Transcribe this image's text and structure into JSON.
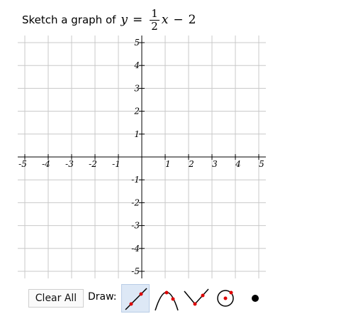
{
  "prompt": {
    "text": "Sketch a graph of",
    "var_y": "y",
    "equals": "=",
    "frac_num": "1",
    "frac_den": "2",
    "var_x": "x",
    "minus": "−",
    "constant": "2"
  },
  "graph": {
    "xlim": [
      -5,
      5
    ],
    "ylim": [
      -5,
      5
    ],
    "x_tick_labels": [
      "-5",
      "-4",
      "-3",
      "-2",
      "-1",
      "1",
      "2",
      "3",
      "4",
      "5"
    ],
    "y_tick_labels": [
      "5",
      "4",
      "3",
      "2",
      "1",
      "-1",
      "-2",
      "-3",
      "-4",
      "-5"
    ],
    "grid": true,
    "colors": {
      "grid": "#c8c8c8",
      "axis": "#000000"
    }
  },
  "toolbar": {
    "clear_label": "Clear All",
    "draw_label": "Draw:",
    "tools": [
      {
        "icon": "line-tool-icon",
        "active": true
      },
      {
        "icon": "parabola-tool-icon",
        "active": false
      },
      {
        "icon": "absolute-value-tool-icon",
        "active": false
      },
      {
        "icon": "circle-tool-icon",
        "active": false
      },
      {
        "icon": "point-tool-icon",
        "active": false
      }
    ],
    "colors": {
      "accent": "#dd0000",
      "active_bg": "#dde8f6"
    }
  }
}
